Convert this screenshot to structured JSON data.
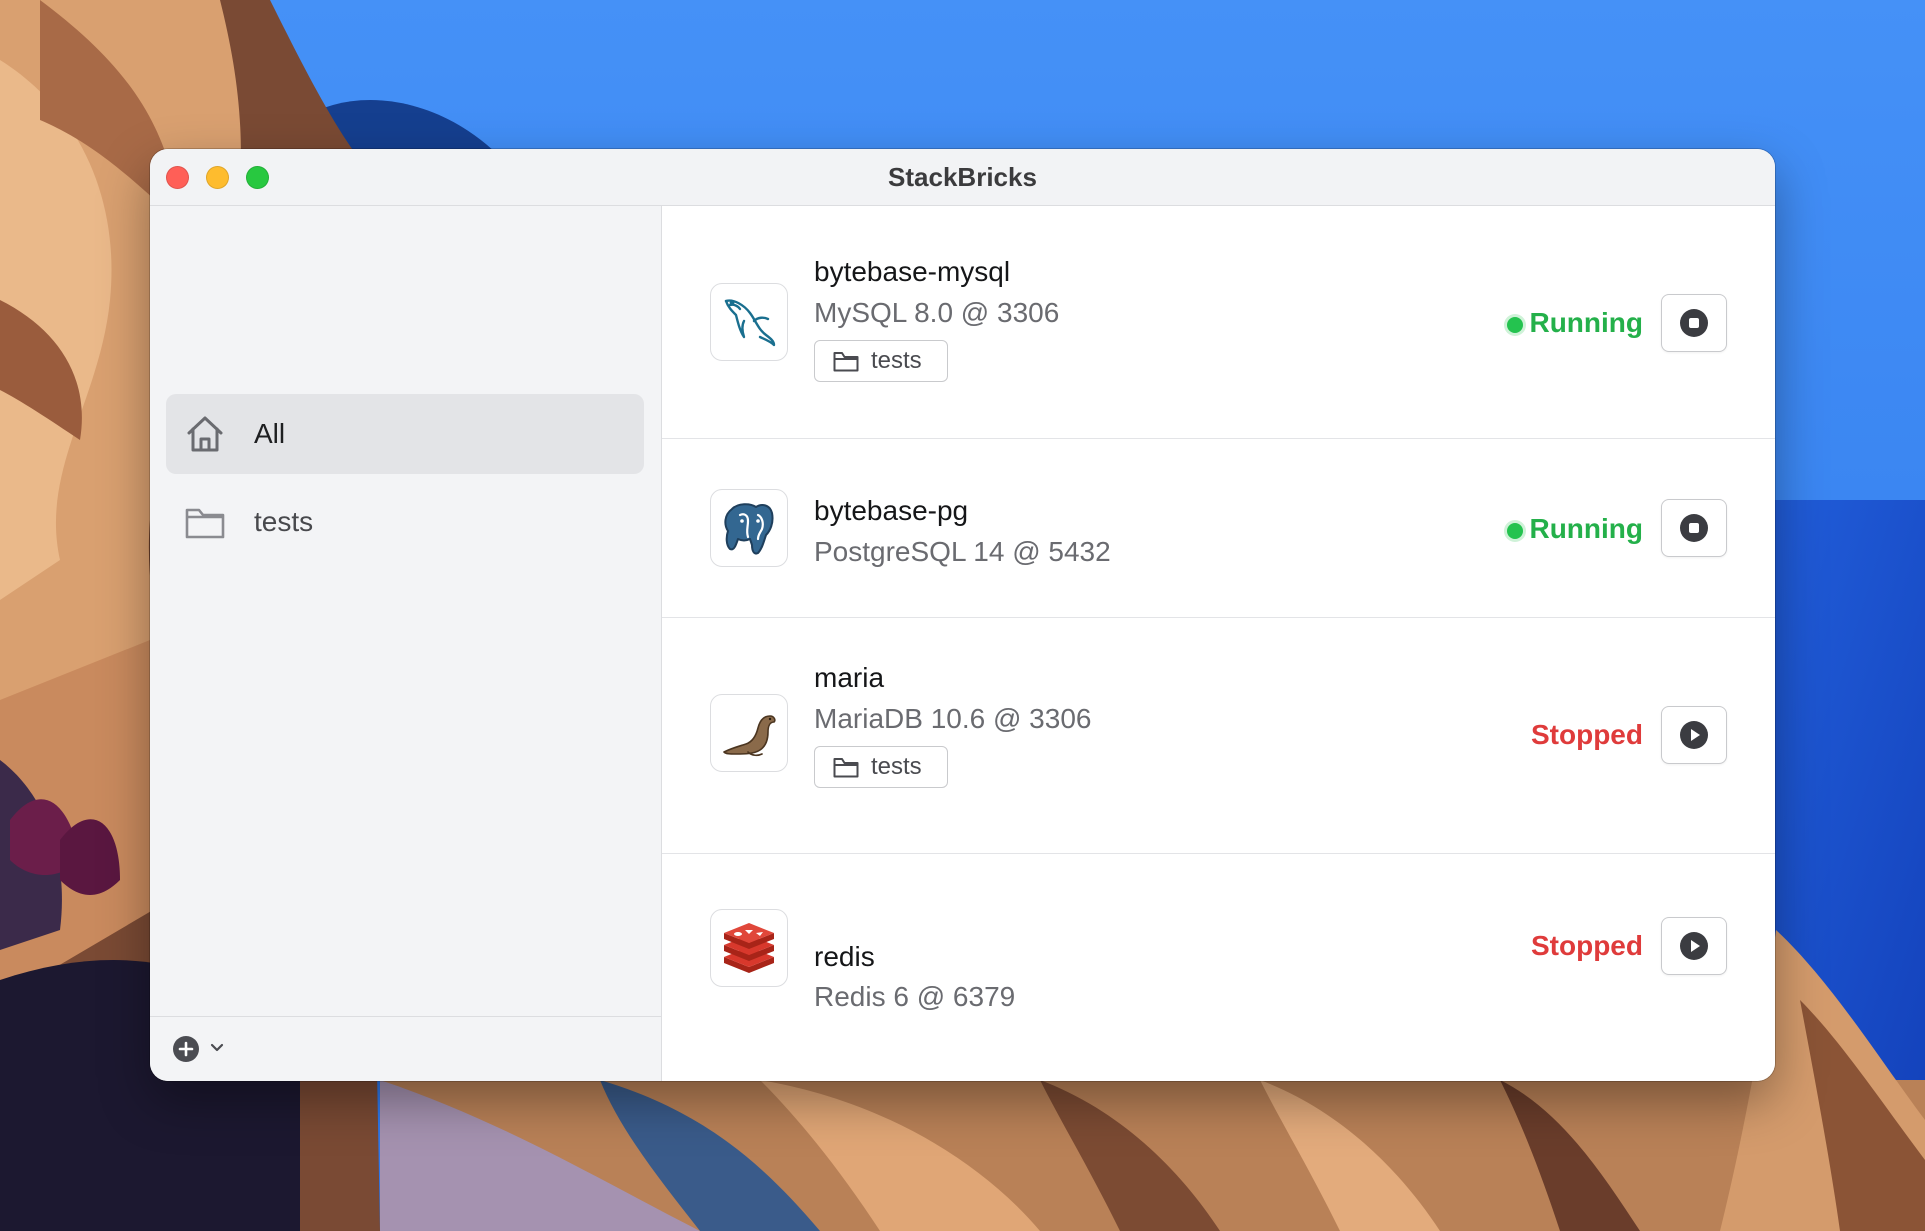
{
  "window": {
    "title": "StackBricks"
  },
  "sidebar": {
    "items": [
      {
        "label": "All",
        "icon": "home-icon",
        "active": true
      },
      {
        "label": "tests",
        "icon": "folder-icon",
        "active": false
      }
    ],
    "footer": {
      "add_icon": "plus-circle-icon",
      "menu_icon": "chevron-down-icon"
    }
  },
  "services": [
    {
      "name": "bytebase-mysql",
      "detail": "MySQL 8.0 @ 3306",
      "tag": "tests",
      "status": "Running",
      "logo": "mysql-dolphin-icon",
      "control": "stop-icon"
    },
    {
      "name": "bytebase-pg",
      "detail": "PostgreSQL 14 @ 5432",
      "tag": "",
      "status": "Running",
      "logo": "postgresql-elephant-icon",
      "control": "stop-icon"
    },
    {
      "name": "maria",
      "detail": "MariaDB 10.6 @ 3306",
      "tag": "tests",
      "status": "Stopped",
      "logo": "mariadb-seal-icon",
      "control": "play-icon"
    },
    {
      "name": "redis",
      "detail": "Redis 6 @ 6379",
      "tag": "",
      "status": "Stopped",
      "logo": "redis-cube-icon",
      "control": "play-icon"
    }
  ],
  "colors": {
    "running": "#24b04a",
    "stopped": "#df3b3b",
    "sidebar_active": "#e3e4e7"
  }
}
